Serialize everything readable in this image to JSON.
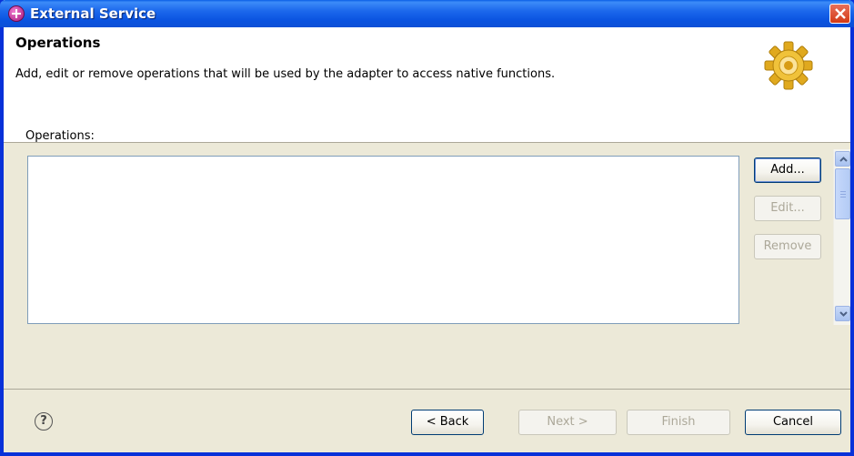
{
  "window": {
    "title": "External Service",
    "icon": "eclipse-plugin-icon",
    "close_icon": "close-icon"
  },
  "header": {
    "title": "Operations",
    "description": "Add, edit or remove operations that will be used by the adapter to access native functions.",
    "banner_icon": "gear-icon"
  },
  "operations": {
    "label": "Operations:",
    "items": [],
    "buttons": {
      "add": "Add...",
      "edit": "Edit...",
      "remove": "Remove"
    }
  },
  "footer": {
    "help_glyph": "?",
    "back": "< Back",
    "next": "Next >",
    "finish": "Finish",
    "cancel": "Cancel"
  },
  "colors": {
    "titlebar": "#0a53e0",
    "dialog_bg": "#ece9d8",
    "close": "#d33a16"
  }
}
